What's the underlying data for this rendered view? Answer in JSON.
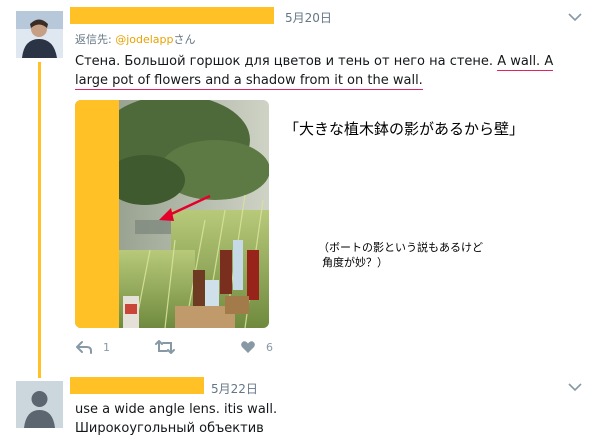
{
  "tweet1": {
    "date": "5月20日",
    "reply_prefix": "返信先:",
    "reply_handle": "@jodelapp",
    "reply_suffix": "さん",
    "text_ru": "Стена. Большой горшок для цветов и тень от него на стене. ",
    "text_en": "A wall. A large pot of flowers and a shadow from it on the wall.",
    "actions": {
      "reply_count": "1",
      "retweet_count": "",
      "like_count": "6"
    }
  },
  "annotations": {
    "note_main": "「大きな植木鉢の影があるから壁」",
    "note_side_line1": "（ボートの影という説もあるけど",
    "note_side_line2": "角度が妙？）"
  },
  "tweet2": {
    "date": "5月22日",
    "line1": "use a wide angle lens. itis wall.",
    "line2": "Широкоугольный объектив"
  },
  "colors": {
    "highlight": "#ffc125",
    "underline": "#e0245e",
    "meta": "#657786",
    "icon": "#8899a6",
    "handle": "#e9a200"
  }
}
